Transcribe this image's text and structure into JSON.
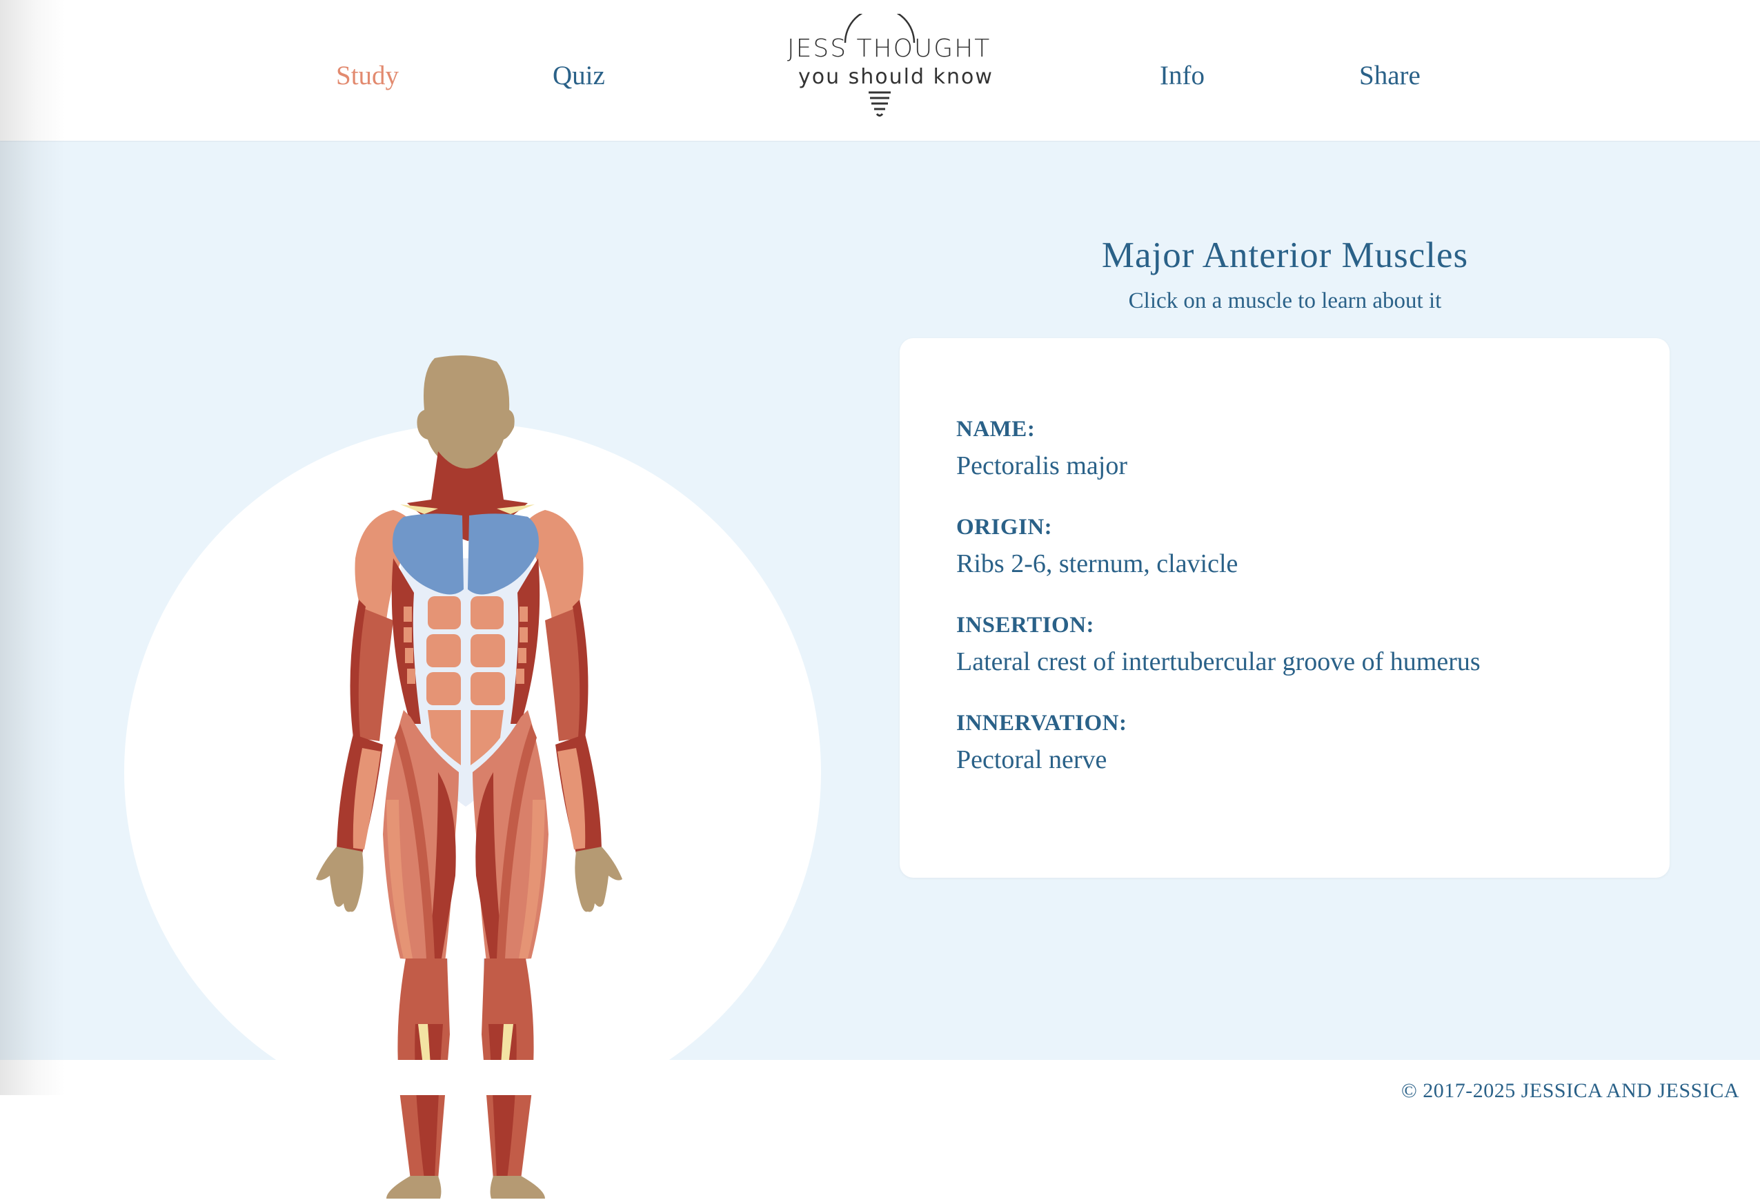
{
  "nav": {
    "items": [
      {
        "label": "Study",
        "active": true
      },
      {
        "label": "Quiz",
        "active": false
      },
      {
        "label": "Info",
        "active": false
      },
      {
        "label": "Share",
        "active": false
      }
    ],
    "logo": {
      "line1": "JESS THOUGHT",
      "line2": "you should know"
    }
  },
  "main": {
    "title": "Major Anterior Muscles",
    "subtitle": "Click on a muscle to learn about it",
    "selected_muscle": "pectoralis-major",
    "info": {
      "name_label": "NAME:",
      "name_value": "Pectoralis major",
      "origin_label": "ORIGIN:",
      "origin_value": "Ribs 2-6, sternum, clavicle",
      "insertion_label": "INSERTION:",
      "insertion_value": "Lateral crest of intertubercular groove of humerus",
      "innervation_label": "INNERVATION:",
      "innervation_value": "Pectoral nerve"
    }
  },
  "footer": {
    "copyright": "© 2017-2025 JESSICA AND JESSICA"
  },
  "colors": {
    "accent": "#2a6188",
    "active_nav": "#e28a6f",
    "background": "#eaf4fb",
    "selected_muscle": "#7097c9",
    "muscle": "#e59475",
    "muscle_dark": "#a83a2e",
    "skin": "#b59a73",
    "tendon": "#e7eef8"
  }
}
